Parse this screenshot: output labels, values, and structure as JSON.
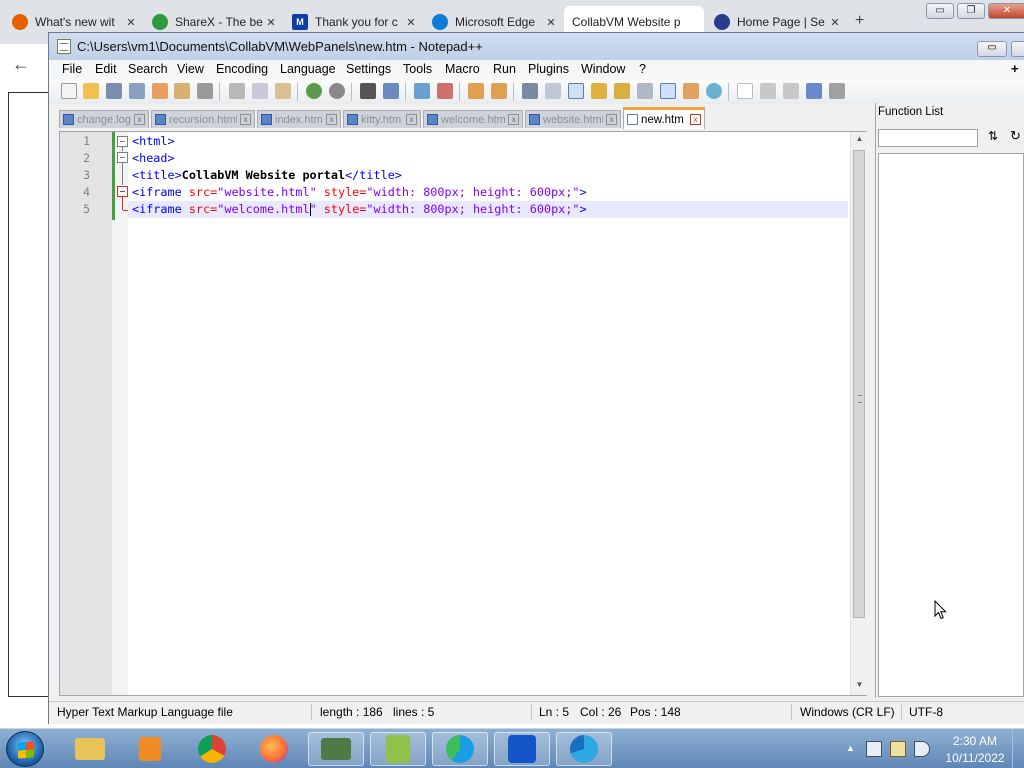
{
  "browser": {
    "tabs": [
      {
        "title": "What's new wit",
        "icon": "firefox-icon",
        "color": "#e66000"
      },
      {
        "title": "ShareX - The be",
        "icon": "sharex-icon",
        "color": "#2b9a3f"
      },
      {
        "title": "Thank you for c",
        "icon": "malwarebytes-icon",
        "color": "#0d3ea8"
      },
      {
        "title": "Microsoft Edge",
        "icon": "edge-icon",
        "color": "#0c7cd5"
      },
      {
        "title": "CollabVM Website p",
        "icon": "",
        "color": ""
      },
      {
        "title": "Home Page | Se",
        "icon": "site-logo-icon",
        "color": "#2a3a8c"
      }
    ],
    "tab_close": "✕",
    "new_tab": "+",
    "back": "←"
  },
  "window_controls": {
    "minimize": "▭",
    "restore": "❐",
    "close": "✕"
  },
  "npp": {
    "title": "C:\\Users\\vm1\\Documents\\CollabVM\\WebPanels\\new.htm - Notepad++",
    "menu": [
      "File",
      "Edit",
      "Search",
      "View",
      "Encoding",
      "Language",
      "Settings",
      "Tools",
      "Macro",
      "Run",
      "Plugins",
      "Window",
      "?"
    ],
    "menu_plus": "+",
    "doc_tabs": [
      {
        "label": "change.log",
        "active": false
      },
      {
        "label": "recursion.html",
        "active": false
      },
      {
        "label": "index.html",
        "active": false
      },
      {
        "label": "kitty.htm",
        "active": false
      },
      {
        "label": "welcome.html",
        "active": false
      },
      {
        "label": "website.html",
        "active": false
      },
      {
        "label": "new.htm",
        "active": true
      }
    ],
    "tab_close": "x",
    "line_numbers": [
      "1",
      "2",
      "3",
      "4",
      "5"
    ],
    "code": {
      "l1_tag": "<html>",
      "l2_tag": "<head>",
      "l3_open": "<title>",
      "l3_text": "CollabVM Website portal",
      "l3_close": "</title>",
      "l4_open": "<iframe",
      "l4_attr1": " src=",
      "l4_val1": "\"website.html\"",
      "l4_attr2": " style=",
      "l4_val2": "\"width: 800px; height: 600px;\"",
      "l4_close": ">",
      "l5_open": "<iframe",
      "l5_attr1": " src=",
      "l5_val1_a": "\"welcome.html",
      "l5_val1_b": "\"",
      "l5_attr2": " style=",
      "l5_val2": "\"width: 800px; height: 600px;\"",
      "l5_close": ">"
    },
    "function_list": {
      "title": "Function List",
      "search_value": ""
    },
    "status": {
      "file_type": "Hyper Text Markup Language file",
      "length": "length : 186",
      "lines": "lines : 5",
      "ln": "Ln : 5",
      "col": "Col : 26",
      "pos": "Pos : 148",
      "eol": "Windows (CR LF)",
      "encoding": "UTF-8"
    }
  },
  "taskbar": {
    "apps": [
      {
        "name": "file-explorer",
        "color": "#e8c35a"
      },
      {
        "name": "media-player",
        "color": "#f08a24"
      },
      {
        "name": "chrome",
        "color": "#db4437"
      },
      {
        "name": "firefox",
        "color": "#ff7139"
      },
      {
        "name": "terminal",
        "color": "#4f7a45"
      },
      {
        "name": "notepad-plus-plus",
        "color": "#90c24a"
      },
      {
        "name": "edge",
        "color": "#1b9de2"
      },
      {
        "name": "malwarebytes",
        "color": "#1456c8"
      },
      {
        "name": "edge-beta",
        "color": "#2ea8e0"
      }
    ],
    "clock_time": "2:30 AM",
    "clock_date": "10/11/2022"
  }
}
